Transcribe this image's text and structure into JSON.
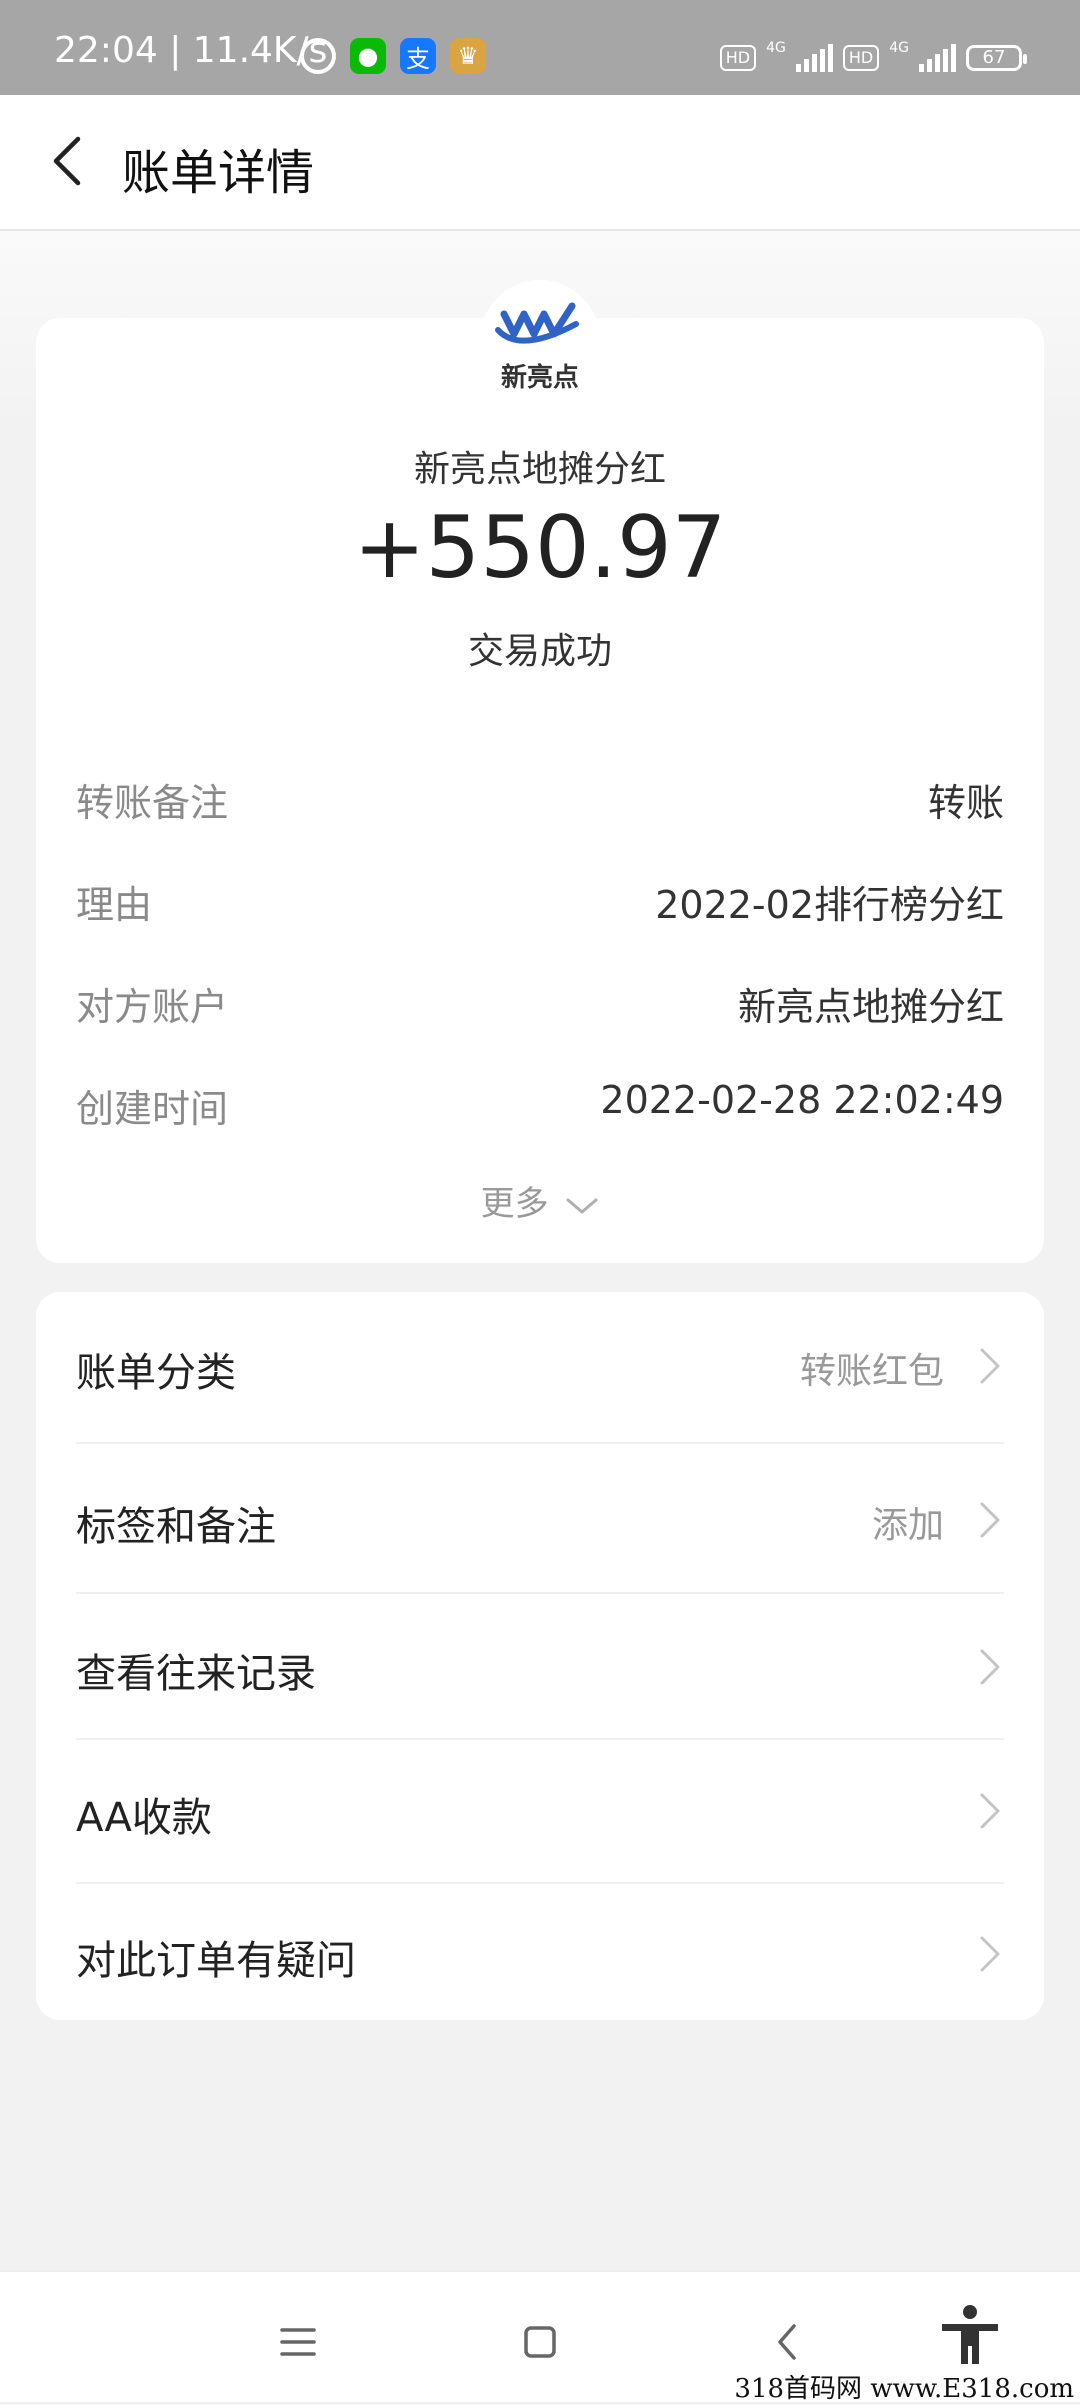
{
  "status_bar": {
    "time_speed": "22:04 | 11.4K/s",
    "hd1": "HD",
    "net1": "4G",
    "hd2": "HD",
    "net2": "4G",
    "battery": "67"
  },
  "header": {
    "title": "账单详情",
    "back_icon": "chevron-left-icon"
  },
  "transaction": {
    "merchant": "新亮点地摊分红",
    "amount": "+550.97",
    "status": "交易成功",
    "logo_text": "新亮点"
  },
  "details": [
    {
      "label": "转账备注",
      "value": "转账"
    },
    {
      "label": "理由",
      "value": "2022-02排行榜分红"
    },
    {
      "label": "对方账户",
      "value": "新亮点地摊分红"
    },
    {
      "label": "创建时间",
      "value": "2022-02-28 22:02:49"
    }
  ],
  "more_label": "更多",
  "menu": [
    {
      "label": "账单分类",
      "value": "转账红包"
    },
    {
      "label": "标签和备注",
      "value": "添加"
    },
    {
      "label": "查看往来记录",
      "value": ""
    },
    {
      "label": "AA收款",
      "value": ""
    },
    {
      "label": "对此订单有疑问",
      "value": ""
    }
  ],
  "nav": {
    "icons": [
      "menu-icon",
      "home-square-icon",
      "back-icon",
      "accessibility-icon"
    ]
  },
  "watermark": "318首码网 www.E318.com",
  "colors": {
    "wechat": "#09bb07",
    "alipay": "#1677ff",
    "logo_blue": "#2f63c8"
  }
}
